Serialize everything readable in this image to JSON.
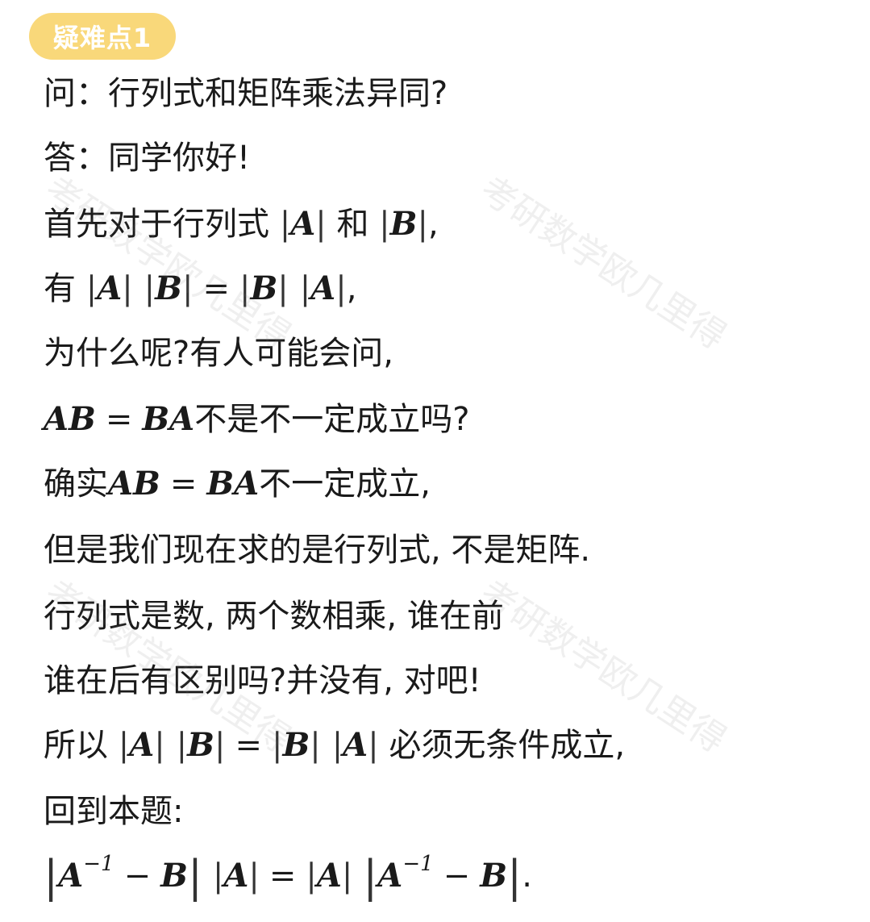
{
  "badge": "疑难点1",
  "lines": {
    "l1": "问：行列式和矩阵乘法异同?",
    "l2": "答：同学你好!",
    "l3a": "首先对于行列式",
    "l3b": "和",
    "l4a": "有",
    "l5": "为什么呢?有人可能会问,",
    "l6b": "不是不一定成立吗?",
    "l7a": "确实",
    "l7b": "不一定成立,",
    "l8": "但是我们现在求的是行列式, 不是矩阵.",
    "l9": "行列式是数, 两个数相乘, 谁在前",
    "l10": "谁在后有区别吗?并没有, 对吧!",
    "l11a": "所以",
    "l11b": "必须无条件成立,",
    "l12": "回到本题:"
  },
  "math": {
    "A": "A",
    "B": "B",
    "AB": "AB",
    "BA": "BA",
    "eq": "=",
    "minus": "−",
    "inv": "−1",
    "comma": ",",
    "period": "."
  },
  "watermark": "考研数学欧几里得"
}
